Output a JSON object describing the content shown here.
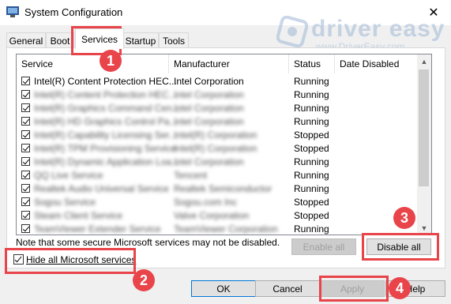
{
  "window": {
    "title": "System Configuration",
    "close_glyph": "✕"
  },
  "watermark": {
    "brand": "driver easy",
    "url": "www.DriverEasy.com"
  },
  "tabs": [
    {
      "label": "General"
    },
    {
      "label": "Boot"
    },
    {
      "label": "Services"
    },
    {
      "label": "Startup"
    },
    {
      "label": "Tools"
    }
  ],
  "services": {
    "columns": [
      "Service",
      "Manufacturer",
      "Status",
      "Date Disabled"
    ],
    "rows": [
      {
        "service": "Intel(R) Content Protection HEC...",
        "manufacturer": "Intel Corporation",
        "status": "Running"
      },
      {
        "service": "Intel(R) Content Protection HEC...",
        "manufacturer": "Intel Corporation",
        "status": "Running"
      },
      {
        "service": "Intel(R) Graphics Command Cen...",
        "manufacturer": "Intel Corporation",
        "status": "Running"
      },
      {
        "service": "Intel(R) HD Graphics Control Pa...",
        "manufacturer": "Intel Corporation",
        "status": "Running"
      },
      {
        "service": "Intel(R) Capability Licensing Ser...",
        "manufacturer": "Intel(R) Corporation",
        "status": "Stopped"
      },
      {
        "service": "Intel(R) TPM Provisioning Service",
        "manufacturer": "Intel(R) Corporation",
        "status": "Stopped"
      },
      {
        "service": "Intel(R) Dynamic Application Loa...",
        "manufacturer": "Intel Corporation",
        "status": "Running"
      },
      {
        "service": "QQ Live Service",
        "manufacturer": "Tencent",
        "status": "Running"
      },
      {
        "service": "Realtek Audio Universal Service",
        "manufacturer": "Realtek Semiconductor",
        "status": "Running"
      },
      {
        "service": "Sogou Service",
        "manufacturer": "Sogou.com Inc",
        "status": "Stopped"
      },
      {
        "service": "Steam Client Service",
        "manufacturer": "Valve Corporation",
        "status": "Stopped"
      },
      {
        "service": "TeamViewer Extender Service",
        "manufacturer": "TeamViewer Corporation",
        "status": "Running"
      }
    ]
  },
  "note": "Note that some secure Microsoft services may not be disabled.",
  "buttons": {
    "enable_all": "Enable all",
    "disable_all": "Disable all",
    "ok": "OK",
    "cancel": "Cancel",
    "apply": "Apply",
    "help": "Help"
  },
  "hide_ms_services": {
    "label": "Hide all Microsoft services",
    "checked": true
  },
  "annotations": [
    "1",
    "2",
    "3",
    "4"
  ],
  "colors": {
    "annotation_red": "#e8444a",
    "focus_blue": "#0078d7"
  }
}
